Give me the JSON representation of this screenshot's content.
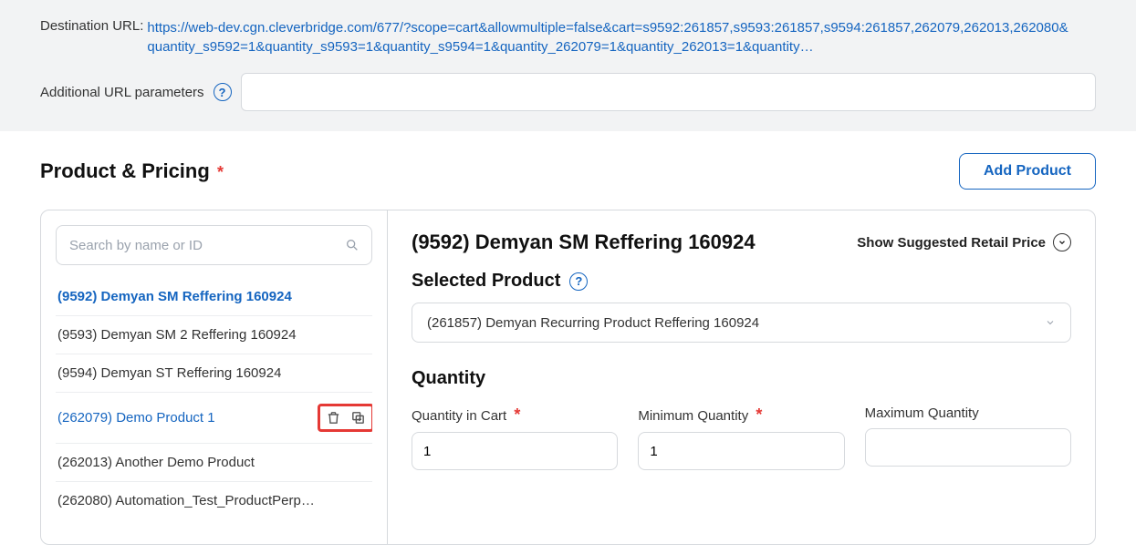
{
  "topbar": {
    "dest_label": "Destination URL:",
    "dest_url": "https://web-dev.cgn.cleverbridge.com/677/?scope=cart&allowmultiple=false&cart=s9592:261857,s9593:261857,s9594:261857,262079,262013,262080&quantity_s9592=1&quantity_s9593=1&quantity_s9594=1&quantity_262079=1&quantity_262013=1&quantity…",
    "addl_label": "Additional URL parameters",
    "addl_value": ""
  },
  "section": {
    "title": "Product & Pricing",
    "add_button": "Add Product"
  },
  "search": {
    "placeholder": "Search by name or ID"
  },
  "product_list": {
    "items": [
      {
        "label": "(9592) Demyan SM Reffering 160924"
      },
      {
        "label": "(9593) Demyan SM 2 Reffering 160924"
      },
      {
        "label": "(9594) Demyan ST Reffering 160924"
      },
      {
        "label": "(262079) Demo Product 1"
      },
      {
        "label": "(262013) Another Demo Product"
      },
      {
        "label": "(262080) Automation_Test_ProductPerp…"
      }
    ]
  },
  "detail": {
    "title": "(9592) Demyan SM Reffering 160924",
    "srp_label": "Show Suggested Retail Price",
    "selected_label": "Selected Product",
    "selected_value": "(261857) Demyan Recurring Product Reffering 160924",
    "qty_title": "Quantity",
    "qty_cart_label": "Quantity in Cart",
    "qty_cart_value": "1",
    "qty_min_label": "Minimum Quantity",
    "qty_min_value": "1",
    "qty_max_label": "Maximum Quantity",
    "qty_max_value": ""
  }
}
